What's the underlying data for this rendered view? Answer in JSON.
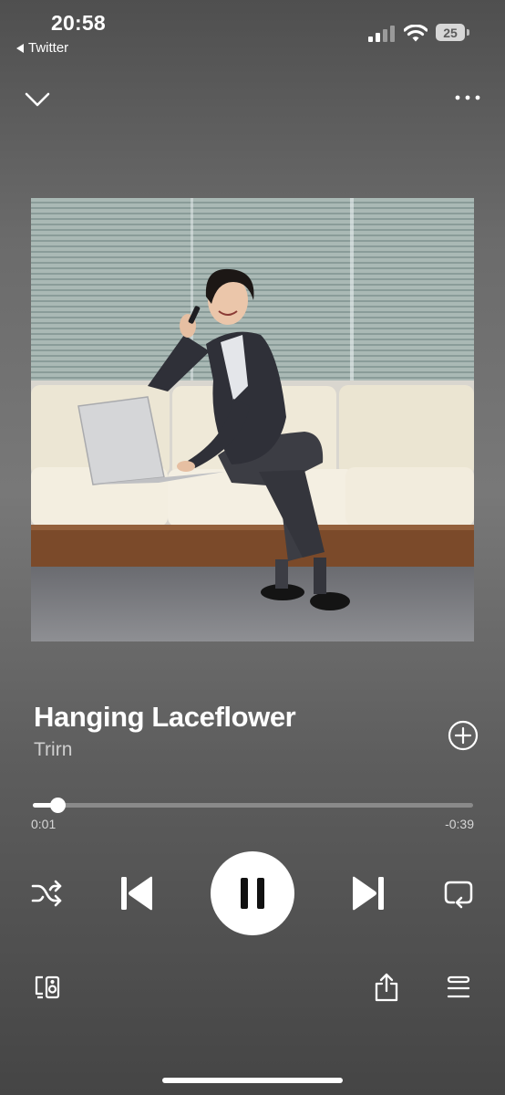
{
  "status_bar": {
    "time": "20:58",
    "back_app_label": "Twitter",
    "battery_level": "25"
  },
  "now_playing": {
    "title": "Hanging Laceflower",
    "artist": "Trirn",
    "artwork_icon": "album-artwork-photo",
    "elapsed": "0:01",
    "remaining": "-0:39",
    "progress_fraction": 0.055
  },
  "icons": {
    "collapse": "chevron-down-icon",
    "more": "more-dots-icon",
    "add": "plus-circle-icon",
    "shuffle": "shuffle-icon",
    "previous": "skip-previous-icon",
    "pause": "pause-icon",
    "next": "skip-next-icon",
    "repeat": "repeat-icon",
    "devices": "connect-device-icon",
    "share": "share-icon",
    "queue": "queue-icon"
  },
  "colors": {
    "background_top": "#4f4f4f",
    "background_bottom": "#454545",
    "accent": "#ffffff",
    "secondary_text": "#cfcfcf"
  }
}
